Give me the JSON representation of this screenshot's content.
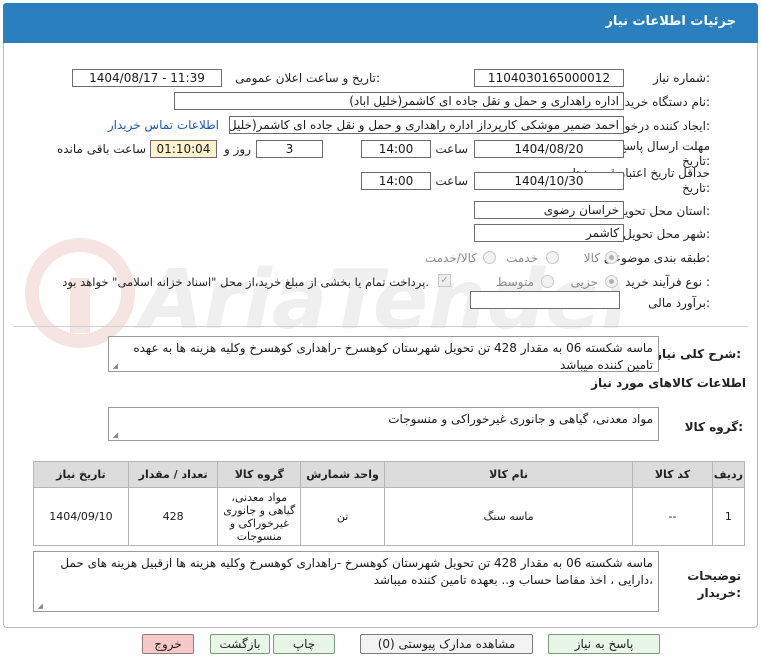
{
  "header": {
    "title": "جزئیات اطلاعات نیاز"
  },
  "form": {
    "need_number": {
      "label": "شماره نیاز:",
      "value": "1104030165000012"
    },
    "announce": {
      "label": "تاریخ و ساعت اعلان عمومی:",
      "value": "1404/08/17 - 11:39"
    },
    "buyer": {
      "label": "نام دستگاه خریدار:",
      "value": "اداره راهداری و حمل و نقل جاده ای کاشمر(خلیل اباد)"
    },
    "creator": {
      "label": "ایجاد کننده درخواست:",
      "value": "احمد ضمیر موشکی کارپرداز اداره راهداری و حمل و نقل جاده ای کاشمر(خلیل اباد)",
      "contact_link": "اطلاعات تماس خریدار"
    },
    "deadline": {
      "label": "مهلت ارسال پاسخ: تا تاریخ:",
      "date": "1404/08/20",
      "time_label": "ساعت",
      "time": "14:00",
      "days": "3",
      "days_label": "روز و",
      "remaining": "01:10:04",
      "remaining_label": "ساعت باقی مانده"
    },
    "validity": {
      "label": "حداقل تاریخ اعتبار قیمت: تا تاریخ:",
      "date": "1404/10/30",
      "time_label": "ساعت",
      "time": "14:00"
    },
    "province": {
      "label": "استان محل تحویل:",
      "value": "خراسان رضوی"
    },
    "city": {
      "label": "شهر محل تحویل:",
      "value": "کاشمر"
    },
    "category": {
      "label": "طبقه بندی موضوعی:",
      "options": [
        "کالا",
        "خدمت",
        "کالا/خدمت"
      ]
    },
    "process": {
      "label": "نوع فرآیند خرید :",
      "options": [
        "جزیی",
        "متوسط"
      ],
      "payment_note": "پرداخت تمام یا بخشی از مبلغ خرید،از محل \"اسناد خزانه اسلامی\" خواهد بود."
    },
    "estimate": {
      "label": "برآورد مالی:",
      "value": ""
    }
  },
  "summary": {
    "label": "شرح کلی نیاز:",
    "text": "ماسه شکسته 06  به مقدار 428 تن تحویل شهرستان کوهسرخ -راهداری کوهسرخ وکلیه هزینه ها به عهده تامین کننده میباشد"
  },
  "goods": {
    "section_title": "اطلاعات کالاهای مورد نیاز",
    "group_label": "گروه کالا:",
    "group_value": "مواد معدنی، گیاهی و جانوری غیرخوراکی و منسوجات"
  },
  "table": {
    "headers": [
      "ردیف",
      "کد کالا",
      "نام کالا",
      "واحد شمارش",
      "گروه کالا",
      "تعداد / مقدار",
      "تاریخ نیاز"
    ],
    "rows": [
      {
        "row": "1",
        "code": "--",
        "name": "ماسه سنگ",
        "unit": "تن",
        "group": "مواد معدنی، گیاهی و جانوری غیرخوراکی و منسوجات",
        "qty": "428",
        "date": "1404/09/10"
      }
    ]
  },
  "notes": {
    "label": "توضیحات خریدار:",
    "text": "ماسه شکسته 06  به مقدار 428 تن تحویل شهرستان کوهسرخ -راهداری کوهسرخ وکلیه هزینه ها ازقبیل هزینه های حمل ،دارایی ، اخذ مفاصا حساب و.. بعهده تامین کننده میباشد"
  },
  "buttons": {
    "respond": "پاسخ به نیاز",
    "attachments": "مشاهده مدارک پیوستی (0)",
    "print": "چاپ",
    "back": "بازگشت",
    "exit": "خروج"
  },
  "colors": {
    "header": "#2a7fbf",
    "link": "#1a55c4",
    "highlight": "#fdf2cd",
    "exit_button": "#f6c9c9"
  }
}
